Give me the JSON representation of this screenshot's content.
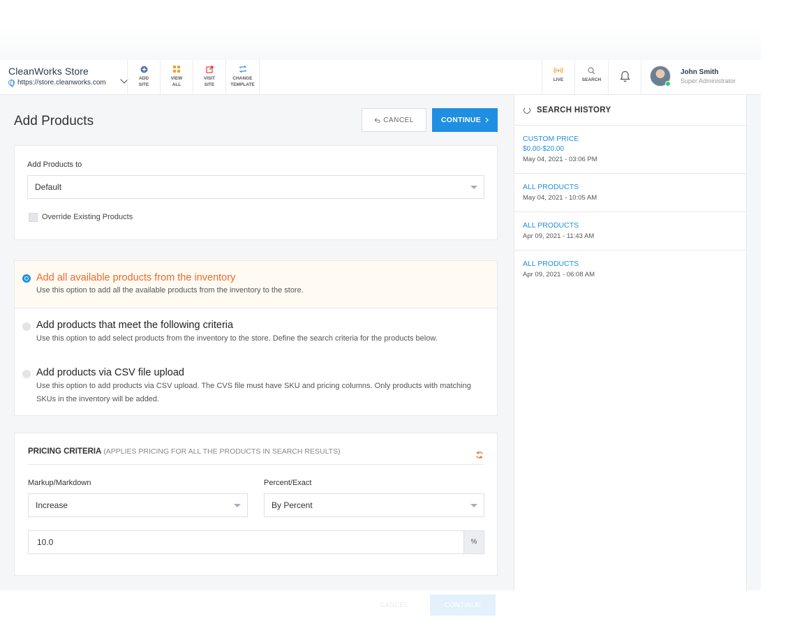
{
  "header": {
    "store_name": "CleanWorks Store",
    "store_url": "https://store.cleanworks.com",
    "tools": [
      {
        "line1": "ADD",
        "line2": "SITE",
        "icon": "plus-circle-icon",
        "color": "#5b78a8"
      },
      {
        "line1": "VIEW",
        "line2": "ALL",
        "icon": "grid-icon",
        "color": "#f0a030"
      },
      {
        "line1": "VISIT",
        "line2": "SITE",
        "icon": "external-link-icon",
        "color": "#e04040"
      },
      {
        "line1": "CHANGE",
        "line2": "TEMPLATE",
        "icon": "swap-icon",
        "color": "#3d8fd8"
      }
    ],
    "live_label": "LIVE",
    "search_label": "SEARCH",
    "user_name": "John Smith",
    "user_role": "Super Administrator"
  },
  "main": {
    "title": "Add Products",
    "cancel_label": "CANCEL",
    "continue_label": "CONTINUE"
  },
  "target": {
    "label": "Add Products to",
    "selected": "Default",
    "override_label": "Override Existing Products"
  },
  "options": [
    {
      "title": "Add all available products from the inventory",
      "desc": "Use this option to add all the available products from the inventory to the store.",
      "selected": true
    },
    {
      "title": "Add products that meet the following criteria",
      "desc": "Use this option to add select products from the inventory to the store. Define the search criteria for the products below.",
      "selected": false
    },
    {
      "title": "Add products via CSV file upload",
      "desc": "Use this option to add products via CSV upload. The CVS file must have SKU and pricing columns. Only products with matching SKUs in the inventory will be added.",
      "selected": false
    }
  ],
  "pricing": {
    "heading": "PRICING CRITERIA",
    "subheading": "(APPLIES PRICING FOR ALL THE PRODUCTS IN SEARCH RESULTS)",
    "markup_label": "Markup/Markdown",
    "markup_value": "Increase",
    "percent_label": "Percent/Exact",
    "percent_value": "By Percent",
    "amount_value": "10.0",
    "amount_unit": "%"
  },
  "history": {
    "title": "SEARCH HISTORY",
    "items": [
      {
        "label": "CUSTOM PRICE",
        "detail": "$0.00-$20.00",
        "date": "May 04, 2021 - 03:06 PM"
      },
      {
        "label": "ALL PRODUCTS",
        "detail": "",
        "date": "May 04, 2021 - 10:05 AM"
      },
      {
        "label": "ALL PRODUCTS",
        "detail": "",
        "date": "Apr 09, 2021 - 11:43 AM"
      },
      {
        "label": "ALL PRODUCTS",
        "detail": "",
        "date": "Apr 09, 2021 - 06:08 AM"
      }
    ]
  },
  "colors": {
    "accent": "#1e8fe1",
    "selected_option": "#ea6a2a"
  }
}
